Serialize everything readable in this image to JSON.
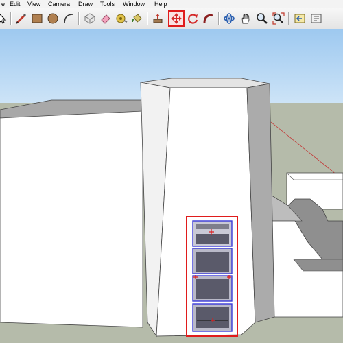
{
  "menubar": {
    "items": [
      "e",
      "Edit",
      "View",
      "Camera",
      "Draw",
      "Tools",
      "Window",
      "Help"
    ]
  },
  "toolbar": {
    "tools": [
      {
        "name": "select-arrow-icon"
      },
      {
        "name": "pencil-line-icon"
      },
      {
        "name": "rectangle-icon"
      },
      {
        "name": "circle-icon"
      },
      {
        "name": "arc-icon"
      },
      {
        "name": "make-component-icon"
      },
      {
        "name": "eraser-icon"
      },
      {
        "name": "tape-measure-icon"
      },
      {
        "name": "paint-bucket-icon"
      },
      {
        "name": "push-pull-icon"
      },
      {
        "name": "move-icon",
        "active": true
      },
      {
        "name": "rotate-icon"
      },
      {
        "name": "follow-me-icon"
      },
      {
        "name": "orbit-icon"
      },
      {
        "name": "pan-hand-icon"
      },
      {
        "name": "zoom-icon"
      },
      {
        "name": "zoom-extents-icon"
      },
      {
        "name": "previous-view-icon"
      },
      {
        "name": "next-view-icon"
      }
    ]
  },
  "colors": {
    "selection": "#e01c1c",
    "selected_faces": "#3a3ad8",
    "sky_top": "#9ec9f0",
    "sky_bottom": "#e6f2fb",
    "ground": "#b5bbaa",
    "wall_light": "#ffffff",
    "wall_shadow": "#ababab",
    "wall_mid": "#d2d2d2"
  }
}
